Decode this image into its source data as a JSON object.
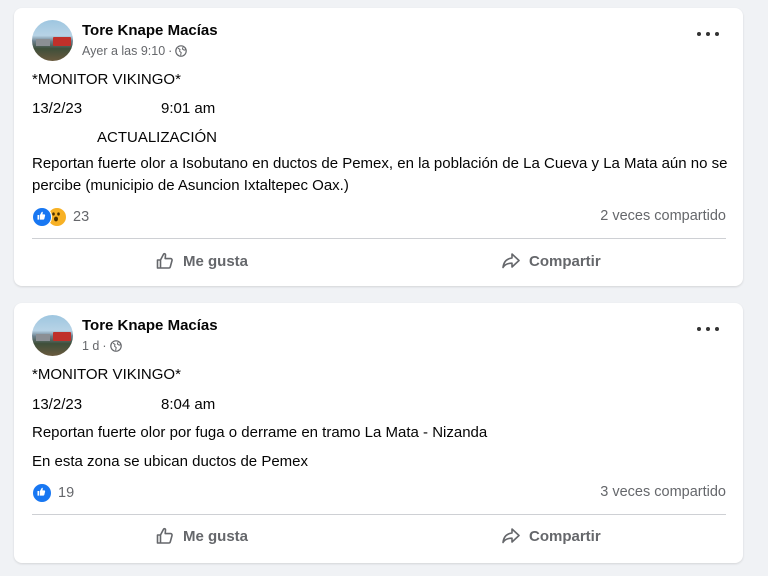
{
  "posts": [
    {
      "author": "Tore Knape Macías",
      "timestamp": "Ayer a las 9:10",
      "separator": "·",
      "heading": "*MONITOR VIKINGO*",
      "date": "13/2/23",
      "time": "9:01 am",
      "subheading": "ACTUALIZACIÓN",
      "body": [
        "Reportan fuerte olor a Isobutano en ductos de Pemex, en la población de La Cueva y La Mata aún no se percibe (municipio de Asuncion Ixtaltepec Oax.)"
      ],
      "reaction_count": "23",
      "reaction_icons": [
        "like-icon",
        "wow-icon"
      ],
      "shares": "2 veces compartido",
      "like_label": "Me gusta",
      "share_label": "Compartir"
    },
    {
      "author": "Tore Knape Macías",
      "timestamp": "1 d",
      "separator": "·",
      "heading": "*MONITOR VIKINGO*",
      "date": "13/2/23",
      "time": "8:04 am",
      "body": [
        "Reportan fuerte olor por fuga o derrame en tramo La Mata - Nizanda",
        "En esta zona se ubican ductos de Pemex"
      ],
      "reaction_count": "19",
      "reaction_icons": [
        "like-icon"
      ],
      "shares": "3 veces compartido",
      "like_label": "Me gusta",
      "share_label": "Compartir"
    }
  ],
  "colors": {
    "background": "#f0f2f5",
    "card": "#ffffff",
    "like_blue": "#1877f2",
    "wow_yellow": "#f7b125",
    "secondary_text": "#65676b"
  }
}
